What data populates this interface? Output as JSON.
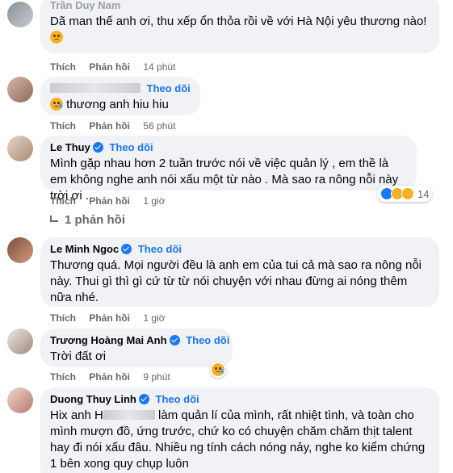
{
  "actions": {
    "like": "Thích",
    "reply": "Phản hồi"
  },
  "comments": [
    {
      "name": "Trần Duy Nam",
      "text": "Dã man thế anh ơi, thu xếp ổn thỏa rồi về với Hà Nội yêu thương nào!",
      "time": "14 phút"
    },
    {
      "name": "",
      "follow": "Theo dõi",
      "text": "thương anh hiu hiu",
      "time": "56 phút"
    },
    {
      "name": "Le Thuy",
      "follow": "Theo dõi",
      "text": "Mình gặp nhau hơn 2 tuần trước nói về việc quản lý , em thề là em không nghe anh nói xấu một từ nào . Mà sao ra nông nỗi này trời ơi .",
      "time": "1 giờ",
      "reaction_count": "14",
      "replies": "1 phản hồi"
    },
    {
      "name": "Le Minh Ngoc",
      "follow": "Theo dõi",
      "text": "Thương quá. Mọi người đều là anh em của tui cả mà sao ra nông nỗi này. Thui gì thì gì cứ từ từ nói chuyện với nhau đừng ai nóng thêm nữa nhé.",
      "time": "1 giờ"
    },
    {
      "name": "Trương Hoàng Mai Anh",
      "follow": "Theo dõi",
      "text": "Trời đất ơi",
      "time": "9 phút"
    },
    {
      "name": "Duong Thuy Linh",
      "follow": "Theo dõi",
      "text_prefix": "Hix anh H",
      "text_rest": "làm quản lí của mình, rất nhiệt tình, và toàn cho mình mượn đồ, ứng trước, chứ ko có chuyện chăm chăm thịt talent hay đi nói xấu đâu. Nhiều ng tính cách nóng nảy, nghe ko kiểm chứng 1 bên xong quy chụp luôn"
    }
  ]
}
